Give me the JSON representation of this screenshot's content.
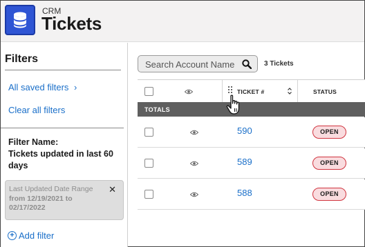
{
  "header": {
    "app_section": "CRM",
    "title": "Tickets",
    "icon": "database-icon",
    "accent_color": "#2f55d4"
  },
  "sidebar": {
    "heading": "Filters",
    "all_saved_filters": "All saved filters",
    "clear_all_filters": "Clear all filters",
    "filter_name_label": "Filter Name:",
    "filter_name_value": "Tickets updated in last 60 days",
    "active_filter": {
      "title": "Last Updated Date Range",
      "value": "from 12/19/2021 to 02/17/2022",
      "close_glyph": "✕"
    },
    "add_filter": "Add filter"
  },
  "search": {
    "placeholder": "Search Account Name",
    "value": ""
  },
  "ticket_count": "3 Tickets",
  "table": {
    "columns": [
      "",
      "",
      "TICKET #",
      "STATUS"
    ],
    "totals_label": "TOTALS",
    "rows": [
      {
        "ticket": "590",
        "status": "OPEN"
      },
      {
        "ticket": "589",
        "status": "OPEN"
      },
      {
        "ticket": "588",
        "status": "OPEN"
      }
    ],
    "status_color": "#d0323d"
  }
}
